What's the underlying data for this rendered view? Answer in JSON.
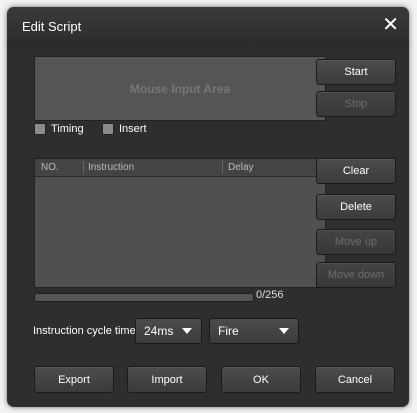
{
  "window": {
    "title": "Edit Script",
    "close_glyph": "✕"
  },
  "mouse_area": {
    "label": "Mouse Input Area"
  },
  "checkboxes": {
    "timing": "Timing",
    "insert": "Insert"
  },
  "list": {
    "columns": [
      "NO.",
      "Instruction",
      "Delay"
    ],
    "rows": []
  },
  "buttons": {
    "start": "Start",
    "stop": "Stop",
    "clear": "Clear",
    "delete": "Delete",
    "move_up": "Move up",
    "move_down": "Move down",
    "export": "Export",
    "import": "Import",
    "ok": "OK",
    "cancel": "Cancel"
  },
  "progress": {
    "count": "0/256",
    "fraction": 0
  },
  "cycle": {
    "label": "Instruction cycle time",
    "time_value": "24ms",
    "mode_value": "Fire"
  },
  "colors": {
    "dialog_bg": "#2e2e2e",
    "disabled_text": "#6d6d6d"
  }
}
